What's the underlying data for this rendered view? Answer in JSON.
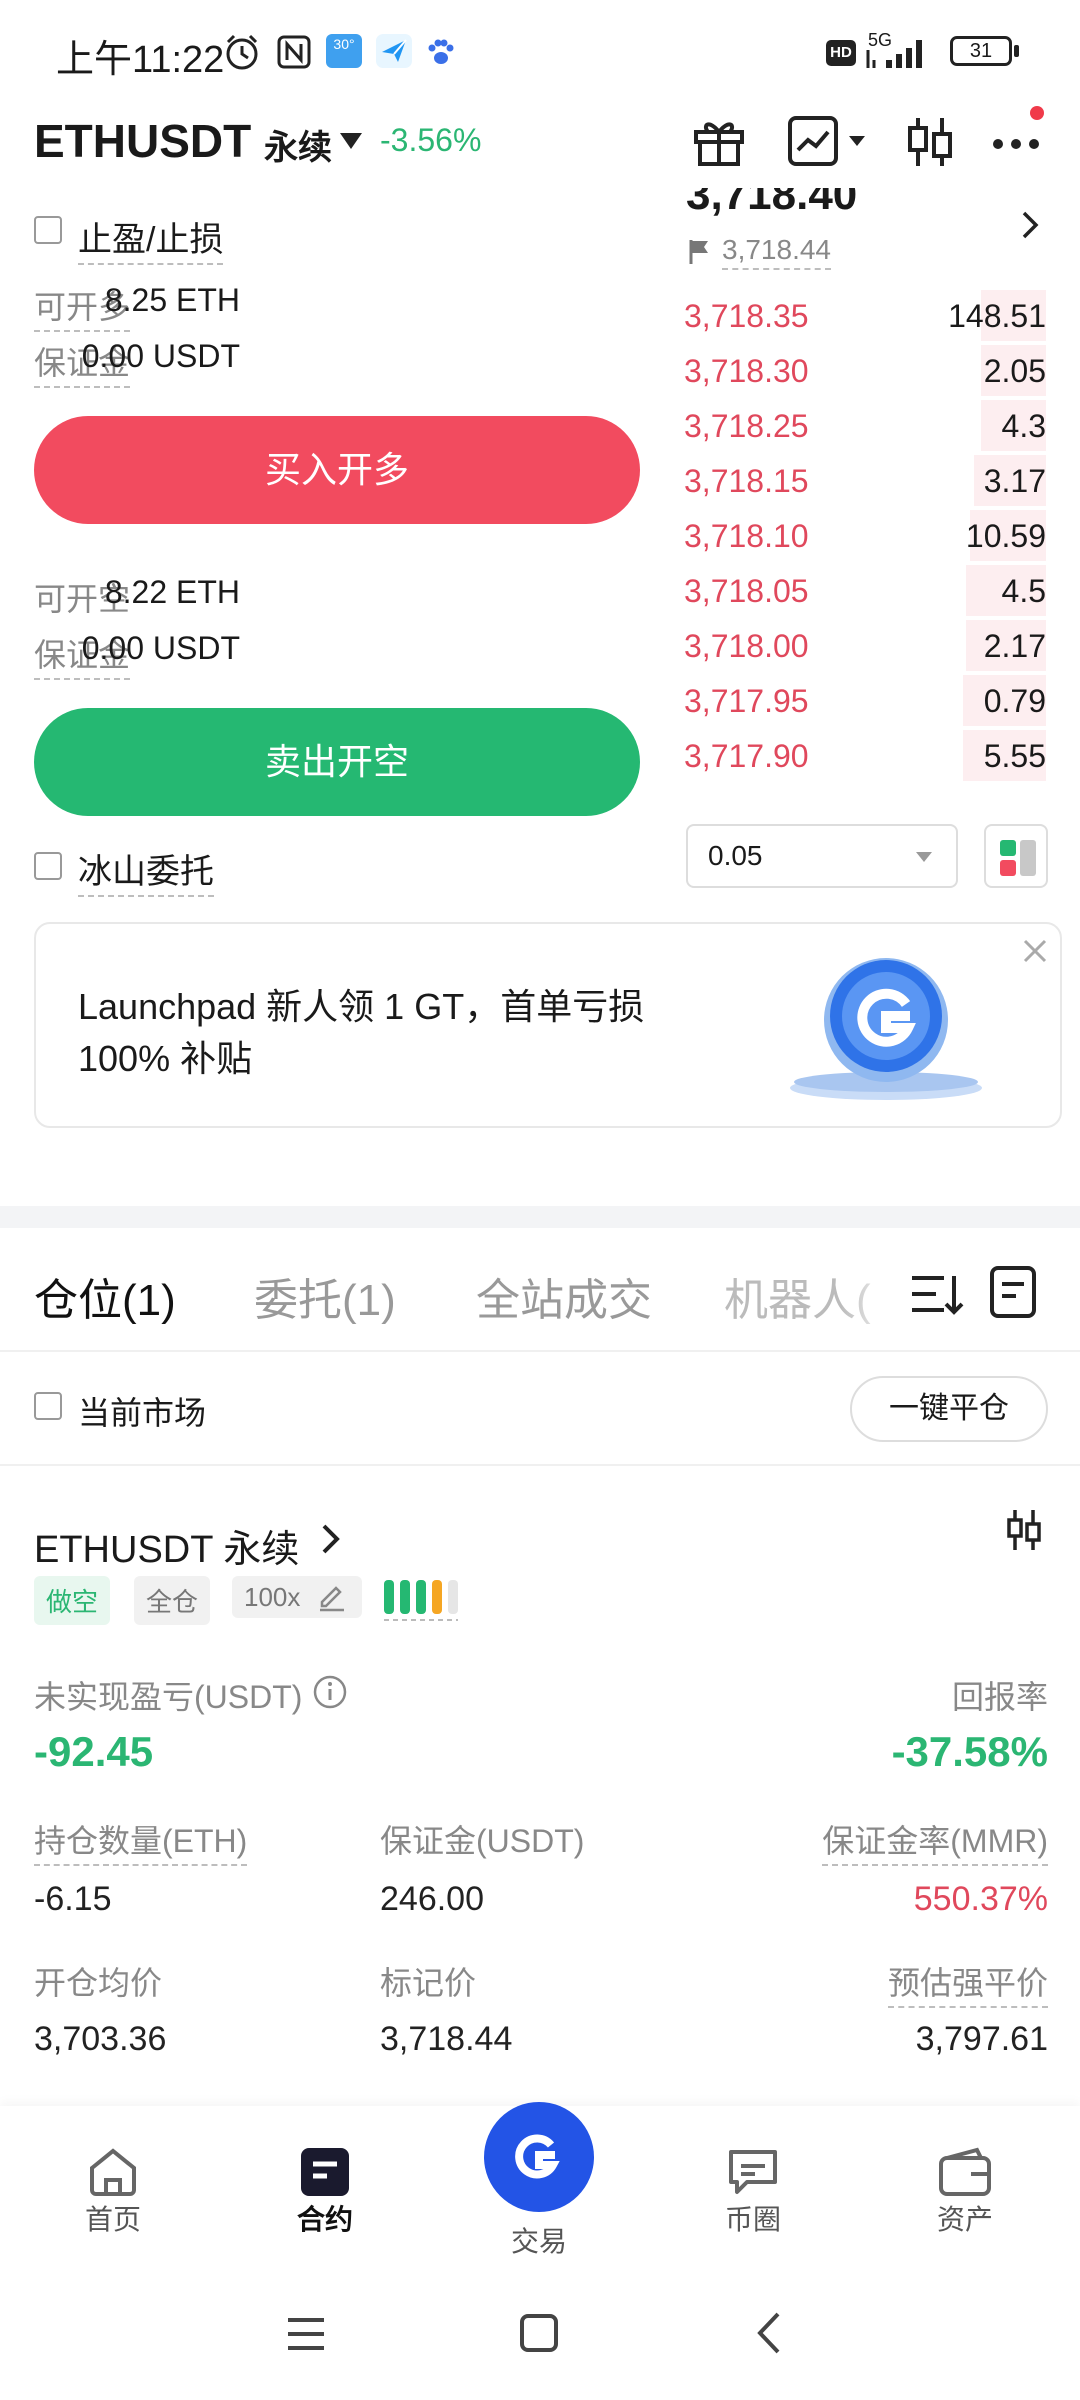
{
  "status_bar": {
    "time": "上午11:22",
    "weather_temp": "30°",
    "network": "5G",
    "hd": "HD",
    "battery": "31"
  },
  "header": {
    "pair": "ETHUSDT",
    "contract_type": "永续",
    "change": "-3.56%"
  },
  "order_form": {
    "tp_sl_label": "止盈/止损",
    "long": {
      "can_open_label": "可开多",
      "can_open_value": "8.25 ETH",
      "margin_label": "保证金",
      "margin_value": "0.00 USDT",
      "button": "买入开多"
    },
    "short": {
      "can_open_label": "可开空",
      "can_open_value": "8.22 ETH",
      "margin_label": "保证金",
      "margin_value": "0.00 USDT",
      "button": "卖出开空"
    },
    "iceberg_label": "冰山委托"
  },
  "orderbook": {
    "last_price": "3,718.40",
    "mark_price": "3,718.44",
    "asks": [
      {
        "price": "3,718.35",
        "qty": "148.51",
        "depth": 0.18
      },
      {
        "price": "3,718.30",
        "qty": "2.05",
        "depth": 0.18
      },
      {
        "price": "3,718.25",
        "qty": "4.3",
        "depth": 0.18
      },
      {
        "price": "3,718.15",
        "qty": "3.17",
        "depth": 0.2
      },
      {
        "price": "3,718.10",
        "qty": "10.59",
        "depth": 0.21
      },
      {
        "price": "3,718.05",
        "qty": "4.5",
        "depth": 0.22
      },
      {
        "price": "3,718.00",
        "qty": "2.17",
        "depth": 0.22
      },
      {
        "price": "3,717.95",
        "qty": "0.79",
        "depth": 0.23
      },
      {
        "price": "3,717.90",
        "qty": "5.55",
        "depth": 0.23
      }
    ],
    "precision": "0.05"
  },
  "promo": {
    "line1": "Launchpad 新人领 1 GT，首单亏损",
    "line2": "100% 补贴"
  },
  "tabs": [
    {
      "label": "仓位(1)",
      "active": true
    },
    {
      "label": "委托(1)",
      "active": false
    },
    {
      "label": "全站成交",
      "active": false
    },
    {
      "label": "机器人(",
      "active": false
    }
  ],
  "filter": {
    "current_market_label": "当前市场",
    "close_all_button": "一键平仓"
  },
  "position": {
    "title": "ETHUSDT 永续",
    "side_badge": "做空",
    "margin_mode_badge": "全仓",
    "leverage_badge": "100x",
    "unrealized_label": "未实现盈亏(USDT)",
    "unrealized_value": "-92.45",
    "roe_label": "回报率",
    "roe_value": "-37.58%",
    "size_label": "持仓数量(ETH)",
    "size_value": "-6.15",
    "margin_label": "保证金(USDT)",
    "margin_value": "246.00",
    "mmr_label": "保证金率(MMR)",
    "mmr_value": "550.37%",
    "entry_label": "开仓均价",
    "entry_value": "3,703.36",
    "mark_label": "标记价",
    "mark_value": "3,718.44",
    "liq_label": "预估强平价",
    "liq_value": "3,797.61"
  },
  "bottom_nav": [
    {
      "label": "首页"
    },
    {
      "label": "合约"
    },
    {
      "label": "交易"
    },
    {
      "label": "币圈"
    },
    {
      "label": "资产"
    }
  ],
  "colors": {
    "green": "#2bb673",
    "red": "#e0485c",
    "buy_button": "#f24b5f",
    "sell_button": "#25b872",
    "brand_blue": "#2354e6"
  }
}
